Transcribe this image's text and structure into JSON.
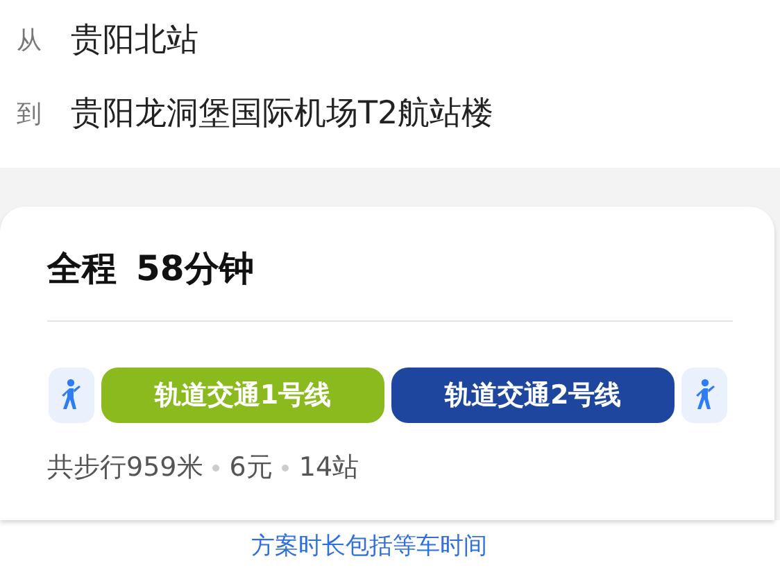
{
  "route": [
    {
      "label": "从",
      "place": "贵阳北站"
    },
    {
      "label": "到",
      "place": "贵阳龙洞堡国际机场T2航站楼"
    }
  ],
  "plan": {
    "title": "全程",
    "duration": "58分钟",
    "segments": [
      {
        "kind": "walk"
      },
      {
        "kind": "line",
        "name": "轨道交通1号线",
        "color": "#8aba1e"
      },
      {
        "kind": "line",
        "name": "轨道交通2号线",
        "color": "#1f469e"
      },
      {
        "kind": "walk"
      }
    ],
    "stats": [
      "共步行959米",
      "6元",
      "14站"
    ]
  },
  "note": "方案时长包括等车时间"
}
